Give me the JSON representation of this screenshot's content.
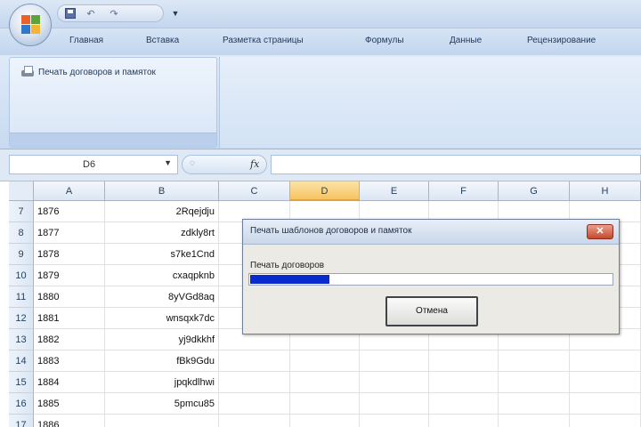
{
  "quick_access": {
    "save_icon": "save-icon",
    "undo_icon": "undo-icon",
    "redo_icon": "redo-icon",
    "more_icon": "customize-qat-icon"
  },
  "ribbon": {
    "tabs": [
      {
        "label": "Главная"
      },
      {
        "label": "Вставка"
      },
      {
        "label": "Разметка страницы"
      },
      {
        "label": "Формулы"
      },
      {
        "label": "Данные"
      },
      {
        "label": "Рецензирование"
      }
    ],
    "print_button_label": "Печать договоров и памяток"
  },
  "formula_bar": {
    "name_box": "D6",
    "fx": "fx",
    "formula": ""
  },
  "sheet": {
    "columns": [
      "A",
      "B",
      "C",
      "D",
      "E",
      "F",
      "G",
      "H"
    ],
    "selected_column": "D",
    "rows": [
      {
        "num": "7",
        "a": "1876",
        "b": "2Rqejdju"
      },
      {
        "num": "8",
        "a": "1877",
        "b": "zdkly8rt"
      },
      {
        "num": "9",
        "a": "1878",
        "b": "s7ke1Cnd"
      },
      {
        "num": "10",
        "a": "1879",
        "b": "cxaqpknb"
      },
      {
        "num": "11",
        "a": "1880",
        "b": "8yVGd8aq"
      },
      {
        "num": "12",
        "a": "1881",
        "b": "wnsqxk7dc"
      },
      {
        "num": "13",
        "a": "1882",
        "b": "yj9dkkhf"
      },
      {
        "num": "14",
        "a": "1883",
        "b": "fBk9Gdu"
      },
      {
        "num": "15",
        "a": "1884",
        "b": "jpqkdlhwi"
      },
      {
        "num": "16",
        "a": "1885",
        "b": "5pmcu85"
      },
      {
        "num": "17",
        "a": "1886",
        "b": ""
      }
    ]
  },
  "dialog": {
    "title": "Печать шаблонов договоров и памяток",
    "status": "Печать договоров",
    "progress": 0.22,
    "cancel_label": "Отмена",
    "close_label": "✕"
  },
  "colors": {
    "progress_fill": "#0a2bcc",
    "selected_column_header": "#f6c461"
  }
}
